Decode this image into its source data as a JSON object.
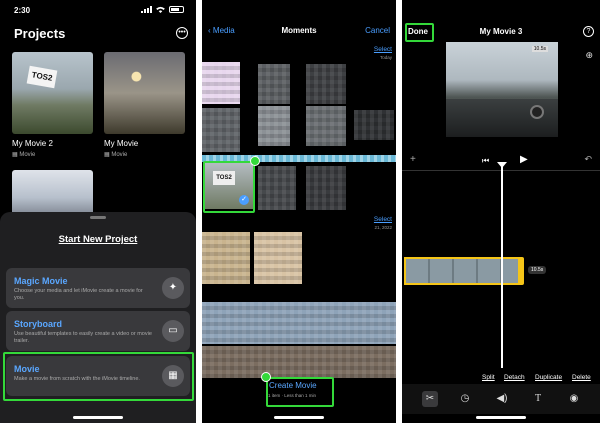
{
  "phone1": {
    "status_time": "2:30",
    "title": "Projects",
    "more_icon": "ellipsis-circle-icon",
    "projects": [
      {
        "name": "My Movie 2",
        "type": "Movie"
      },
      {
        "name": "My Movie",
        "type": "Movie"
      }
    ],
    "thumb_sign": "TOS2",
    "start_new_project": "Start New Project",
    "options": [
      {
        "title": "Magic Movie",
        "desc": "Choose your media and let iMovie create a movie for you.",
        "icon": "magic-wand-icon"
      },
      {
        "title": "Storyboard",
        "desc": "Use beautiful templates to easily create a video or movie trailer.",
        "icon": "storyboard-icon"
      },
      {
        "title": "Movie",
        "desc": "Make a movie from scratch with the iMovie timeline.",
        "icon": "film-icon"
      }
    ]
  },
  "phone2": {
    "back_label": "Media",
    "title": "Moments",
    "cancel_label": "Cancel",
    "select_label": "Select",
    "section1_sub": "Today",
    "section2_sub": "21, 2022",
    "create_movie": "Create Movie",
    "create_sub": "1 item · Less than 1 min"
  },
  "phone3": {
    "done_label": "Done",
    "title": "My Movie 3",
    "help_icon": "question-circle-icon",
    "viewer_time": "10.5s",
    "clip_duration": "10.5s",
    "actions": [
      "Split",
      "Detach",
      "Duplicate",
      "Delete"
    ],
    "tools": [
      "scissors-icon",
      "speed-icon",
      "volume-icon",
      "text-icon",
      "filters-icon"
    ]
  },
  "colors": {
    "highlight": "#34d93a",
    "accent_blue": "#5aa7ff",
    "clip_yellow": "#f5c518"
  }
}
